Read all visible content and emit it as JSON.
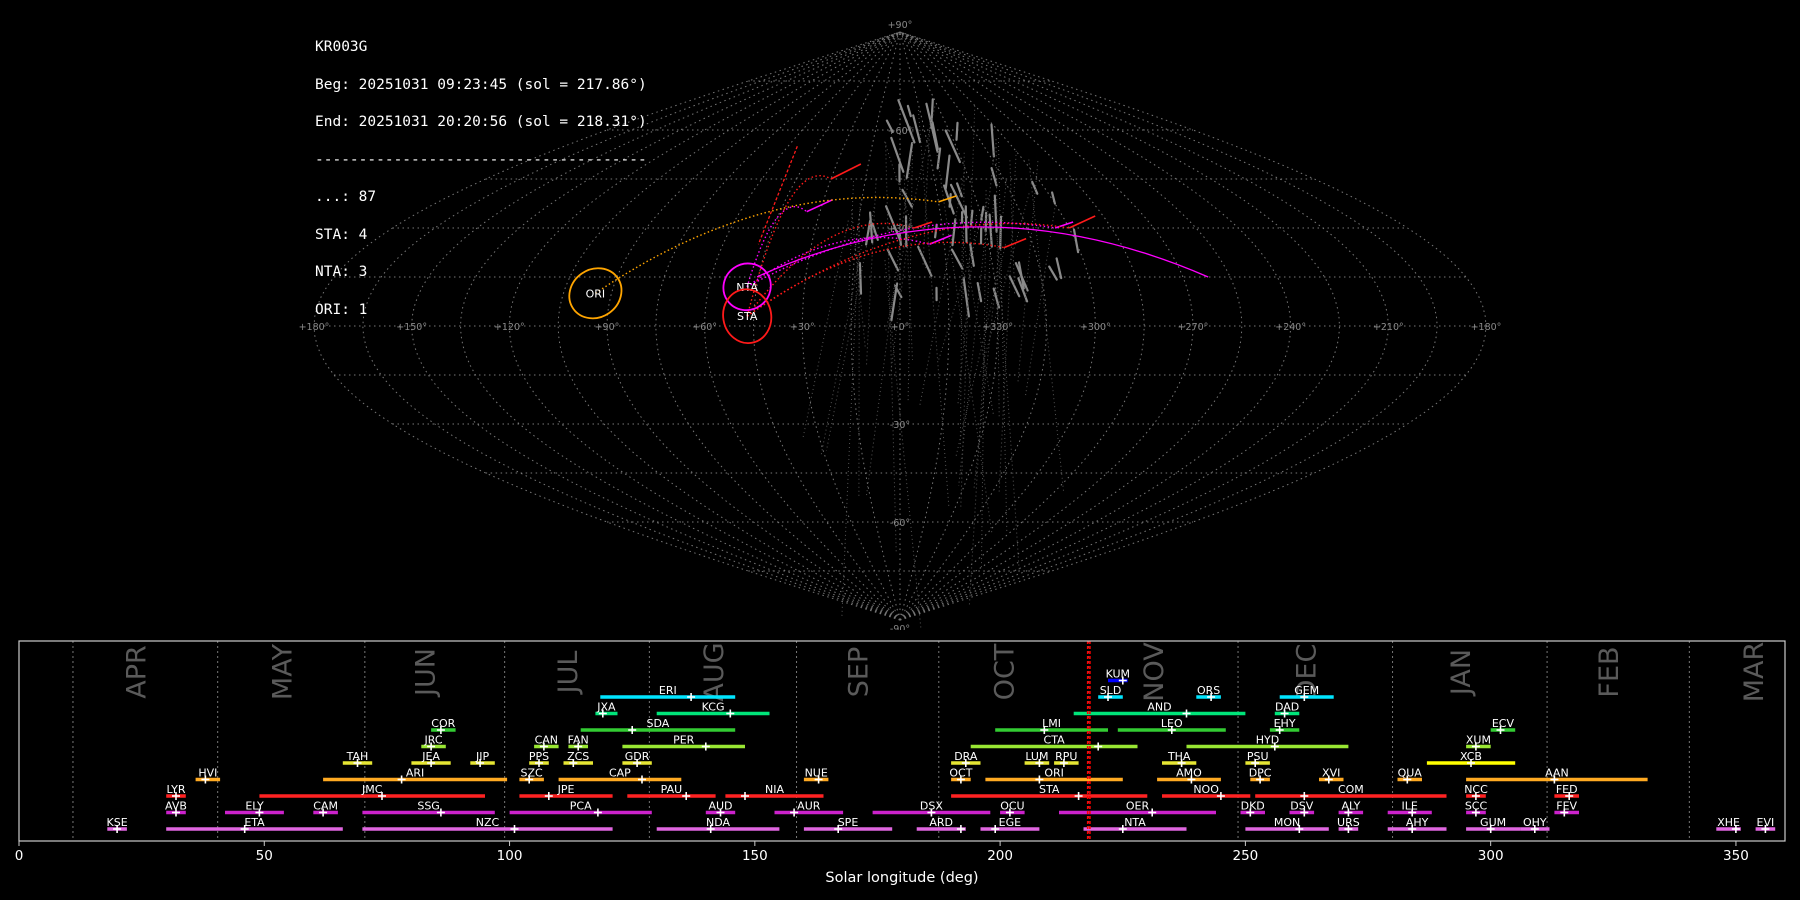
{
  "info": {
    "lines": [
      "KR003G",
      "Beg: 20251031 09:23:45 (sol = 217.86°)",
      "End: 20251031 20:20:56 (sol = 218.31°)",
      "--------------------------------------",
      "...: 87",
      "STA: 4",
      "NTA: 3",
      "ORI: 1"
    ]
  },
  "sky_map": {
    "projection": "sinusoidal",
    "lon_labels": [
      "+180°",
      "+150°",
      "+120°",
      "+90°",
      "+60°",
      "+30°",
      "+0°",
      "+330°",
      "+300°",
      "+270°",
      "+240°",
      "+210°",
      "+180°"
    ],
    "lat_labels": [
      "+90°",
      "+60°",
      "+30°",
      "-30°",
      "-60°",
      "-90°"
    ],
    "radiants": [
      {
        "code": "NTA",
        "lon": 48,
        "lat": 12,
        "color": "#ff00ff"
      },
      {
        "code": "STA",
        "lon": 47,
        "lat": 3,
        "color": "#ff1a1a"
      },
      {
        "code": "ORI",
        "lon": 95,
        "lat": 10,
        "color": "#ffa500"
      }
    ],
    "colors": {
      "sporadic": "#999999",
      "grid": "#777777",
      "text": "#ffffff"
    }
  },
  "chart_data": {
    "type": "timeline",
    "xlabel": "Solar longitude (deg)",
    "xlim": [
      0,
      360
    ],
    "xticks": [
      0,
      50,
      100,
      150,
      200,
      250,
      300,
      350
    ],
    "current_sol": [
      217.86,
      218.31
    ],
    "current_color": "#ff0000",
    "months": [
      {
        "name": "APR",
        "start": 11
      },
      {
        "name": "MAY",
        "start": 40.5
      },
      {
        "name": "JUN",
        "start": 70.5
      },
      {
        "name": "JUL",
        "start": 99
      },
      {
        "name": "AUG",
        "start": 128.5
      },
      {
        "name": "SEP",
        "start": 158.5
      },
      {
        "name": "OCT",
        "start": 187.5
      },
      {
        "name": "NOV",
        "start": 218
      },
      {
        "name": "DEC",
        "start": 248.5
      },
      {
        "name": "JAN",
        "start": 280
      },
      {
        "name": "FEB",
        "start": 311.5
      },
      {
        "name": "MAR",
        "start": 340.5
      }
    ],
    "showers": [
      {
        "code": "KUM",
        "start": 222,
        "end": 226,
        "peak": 225,
        "row": 9,
        "color": "#0000ff"
      },
      {
        "code": "ERI",
        "start": 118.5,
        "end": 146,
        "peak": 137,
        "row": 8,
        "color": "#00e5ff"
      },
      {
        "code": "SLD",
        "start": 220,
        "end": 225,
        "peak": 222,
        "row": 8,
        "color": "#00e5ff"
      },
      {
        "code": "ORS",
        "start": 240,
        "end": 245,
        "peak": 243,
        "row": 8,
        "color": "#00e5ff"
      },
      {
        "code": "GEM",
        "start": 257,
        "end": 268,
        "peak": 262,
        "row": 8,
        "color": "#00e5ff"
      },
      {
        "code": "JXA",
        "start": 117.5,
        "end": 122,
        "peak": 119,
        "row": 7,
        "color": "#00e57a"
      },
      {
        "code": "KCG",
        "start": 130,
        "end": 153,
        "peak": 145,
        "row": 7,
        "color": "#00e57a"
      },
      {
        "code": "AND",
        "start": 215,
        "end": 250,
        "peak": 238,
        "row": 7,
        "color": "#00e57a"
      },
      {
        "code": "DAD",
        "start": 256,
        "end": 261,
        "peak": 258,
        "row": 7,
        "color": "#00e57a"
      },
      {
        "code": "COR",
        "start": 84,
        "end": 89,
        "peak": 86,
        "row": 6,
        "color": "#33cc33"
      },
      {
        "code": "SDA",
        "start": 114.5,
        "end": 146,
        "peak": 125,
        "row": 6,
        "color": "#33cc33"
      },
      {
        "code": "LMI",
        "start": 199,
        "end": 222,
        "peak": 209,
        "row": 6,
        "color": "#33cc33"
      },
      {
        "code": "LEO",
        "start": 224,
        "end": 246,
        "peak": 235,
        "row": 6,
        "color": "#33cc33"
      },
      {
        "code": "EHY",
        "start": 255,
        "end": 261,
        "peak": 257,
        "row": 6,
        "color": "#33cc33"
      },
      {
        "code": "ECV",
        "start": 300,
        "end": 305,
        "peak": 302,
        "row": 6,
        "color": "#33cc33"
      },
      {
        "code": "JRC",
        "start": 82,
        "end": 87,
        "peak": 84,
        "row": 5,
        "color": "#99e633"
      },
      {
        "code": "CAN",
        "start": 105,
        "end": 110,
        "peak": 107,
        "row": 5,
        "color": "#99e633"
      },
      {
        "code": "FAN",
        "start": 112,
        "end": 116,
        "peak": 114,
        "row": 5,
        "color": "#99e633"
      },
      {
        "code": "PER",
        "start": 123,
        "end": 148,
        "peak": 140,
        "row": 5,
        "color": "#99e633"
      },
      {
        "code": "CTA",
        "start": 194,
        "end": 228,
        "peak": 220,
        "row": 5,
        "color": "#99e633"
      },
      {
        "code": "HYD",
        "start": 238,
        "end": 271,
        "peak": 256,
        "row": 5,
        "color": "#99e633"
      },
      {
        "code": "XUM",
        "start": 295,
        "end": 300,
        "peak": 297,
        "row": 5,
        "color": "#99e633"
      },
      {
        "code": "TAH",
        "start": 66,
        "end": 72,
        "peak": 69,
        "row": 4,
        "color": "#e6e633"
      },
      {
        "code": "JEA",
        "start": 80,
        "end": 88,
        "peak": 84,
        "row": 4,
        "color": "#e6e633"
      },
      {
        "code": "JIP",
        "start": 92,
        "end": 97,
        "peak": 94,
        "row": 4,
        "color": "#e6e633"
      },
      {
        "code": "PPS",
        "start": 104,
        "end": 108,
        "peak": 106,
        "row": 4,
        "color": "#e6e633"
      },
      {
        "code": "ZCS",
        "start": 111,
        "end": 117,
        "peak": 113,
        "row": 4,
        "color": "#e6e633"
      },
      {
        "code": "GDR",
        "start": 123,
        "end": 129,
        "peak": 126,
        "row": 4,
        "color": "#e6e633"
      },
      {
        "code": "DRA",
        "start": 190,
        "end": 196,
        "peak": 193,
        "row": 4,
        "color": "#e6e633"
      },
      {
        "code": "LUM",
        "start": 205,
        "end": 210,
        "peak": 208,
        "row": 4,
        "color": "#e6e633"
      },
      {
        "code": "RPU",
        "start": 211,
        "end": 216,
        "peak": 213,
        "row": 4,
        "color": "#e6e633"
      },
      {
        "code": "THA",
        "start": 233,
        "end": 240,
        "peak": 237,
        "row": 4,
        "color": "#e6e633"
      },
      {
        "code": "PSU",
        "start": 250,
        "end": 255,
        "peak": 252,
        "row": 4,
        "color": "#e6e633"
      },
      {
        "code": "XCB",
        "start": 287,
        "end": 305,
        "peak": 296,
        "row": 4,
        "color": "#ffff00"
      },
      {
        "code": "HVI",
        "start": 36,
        "end": 41,
        "peak": 38,
        "row": 3,
        "color": "#ffaa22"
      },
      {
        "code": "ARI",
        "start": 62,
        "end": 99.5,
        "peak": 78,
        "row": 3,
        "color": "#ffaa22"
      },
      {
        "code": "SZC",
        "start": 102,
        "end": 107,
        "peak": 104,
        "row": 3,
        "color": "#ffaa22"
      },
      {
        "code": "CAP",
        "start": 110,
        "end": 135,
        "peak": 127,
        "row": 3,
        "color": "#ffaa22"
      },
      {
        "code": "NUE",
        "start": 160,
        "end": 165,
        "peak": 163,
        "row": 3,
        "color": "#ffaa22"
      },
      {
        "code": "OCT",
        "start": 190,
        "end": 194,
        "peak": 192,
        "row": 3,
        "color": "#ffaa22"
      },
      {
        "code": "ORI",
        "start": 197,
        "end": 225,
        "peak": 208,
        "row": 3,
        "color": "#ffaa22"
      },
      {
        "code": "AMO",
        "start": 232,
        "end": 245,
        "peak": 239,
        "row": 3,
        "color": "#ffaa22"
      },
      {
        "code": "DPC",
        "start": 251,
        "end": 255,
        "peak": 253,
        "row": 3,
        "color": "#ffaa22"
      },
      {
        "code": "XVI",
        "start": 265,
        "end": 270,
        "peak": 267,
        "row": 3,
        "color": "#ffaa22"
      },
      {
        "code": "QUA",
        "start": 281,
        "end": 286,
        "peak": 283,
        "row": 3,
        "color": "#ffaa22"
      },
      {
        "code": "AAN",
        "start": 295,
        "end": 332,
        "peak": 313,
        "row": 3,
        "color": "#ffaa22"
      },
      {
        "code": "LYR",
        "start": 30,
        "end": 34,
        "peak": 32,
        "row": 2,
        "color": "#ff2222"
      },
      {
        "code": "JMC",
        "start": 49,
        "end": 95,
        "peak": 74,
        "row": 2,
        "color": "#ff2222"
      },
      {
        "code": "JPE",
        "start": 102,
        "end": 121,
        "peak": 108,
        "row": 2,
        "color": "#ff2222"
      },
      {
        "code": "PAU",
        "start": 124,
        "end": 142,
        "peak": 136,
        "row": 2,
        "color": "#ff2222"
      },
      {
        "code": "NIA",
        "start": 144,
        "end": 164,
        "peak": 148,
        "row": 2,
        "color": "#ff2222"
      },
      {
        "code": "STA",
        "start": 190,
        "end": 230,
        "peak": 216,
        "row": 2,
        "color": "#ff2222"
      },
      {
        "code": "NOO",
        "start": 233,
        "end": 251,
        "peak": 245,
        "row": 2,
        "color": "#ff2222"
      },
      {
        "code": "COM",
        "start": 252,
        "end": 291,
        "peak": 262,
        "row": 2,
        "color": "#ff2222"
      },
      {
        "code": "NCC",
        "start": 295,
        "end": 299,
        "peak": 297,
        "row": 2,
        "color": "#ff2222"
      },
      {
        "code": "FED",
        "start": 313,
        "end": 318,
        "peak": 316,
        "row": 2,
        "color": "#ff2222"
      },
      {
        "code": "AVB",
        "start": 30,
        "end": 34,
        "peak": 32,
        "row": 1,
        "color": "#cc22cc"
      },
      {
        "code": "ELY",
        "start": 42,
        "end": 54,
        "peak": 49,
        "row": 1,
        "color": "#cc22cc"
      },
      {
        "code": "CAM",
        "start": 60,
        "end": 65,
        "peak": 62,
        "row": 1,
        "color": "#cc22cc"
      },
      {
        "code": "SSG",
        "start": 70,
        "end": 97,
        "peak": 86,
        "row": 1,
        "color": "#cc22cc"
      },
      {
        "code": "PCA",
        "start": 100,
        "end": 129,
        "peak": 118,
        "row": 1,
        "color": "#cc22cc"
      },
      {
        "code": "AUD",
        "start": 140,
        "end": 146,
        "peak": 143,
        "row": 1,
        "color": "#cc22cc"
      },
      {
        "code": "AUR",
        "start": 154,
        "end": 168,
        "peak": 158,
        "row": 1,
        "color": "#cc22cc"
      },
      {
        "code": "DSX",
        "start": 174,
        "end": 198,
        "peak": 186,
        "row": 1,
        "color": "#cc22cc"
      },
      {
        "code": "OCU",
        "start": 200,
        "end": 205,
        "peak": 202,
        "row": 1,
        "color": "#cc22cc"
      },
      {
        "code": "OER",
        "start": 212,
        "end": 244,
        "peak": 231,
        "row": 1,
        "color": "#cc22cc"
      },
      {
        "code": "DKD",
        "start": 249,
        "end": 254,
        "peak": 251,
        "row": 1,
        "color": "#cc22cc"
      },
      {
        "code": "DSV",
        "start": 259,
        "end": 264,
        "peak": 262,
        "row": 1,
        "color": "#cc22cc"
      },
      {
        "code": "ALY",
        "start": 269,
        "end": 274,
        "peak": 271,
        "row": 1,
        "color": "#cc22cc"
      },
      {
        "code": "ILE",
        "start": 279,
        "end": 288,
        "peak": 284,
        "row": 1,
        "color": "#cc22cc"
      },
      {
        "code": "SCC",
        "start": 295,
        "end": 299,
        "peak": 297,
        "row": 1,
        "color": "#cc22cc"
      },
      {
        "code": "FEV",
        "start": 313,
        "end": 318,
        "peak": 315,
        "row": 1,
        "color": "#cc22cc"
      },
      {
        "code": "KSE",
        "start": 18,
        "end": 22,
        "peak": 20,
        "row": 0,
        "color": "#e066e0"
      },
      {
        "code": "ETA",
        "start": 30,
        "end": 66,
        "peak": 46,
        "row": 0,
        "color": "#e066e0"
      },
      {
        "code": "NZC",
        "start": 70,
        "end": 121,
        "peak": 101,
        "row": 0,
        "color": "#e066e0"
      },
      {
        "code": "NDA",
        "start": 130,
        "end": 155,
        "peak": 141,
        "row": 0,
        "color": "#e066e0"
      },
      {
        "code": "SPE",
        "start": 160,
        "end": 178,
        "peak": 167,
        "row": 0,
        "color": "#e066e0"
      },
      {
        "code": "ARD",
        "start": 183,
        "end": 193,
        "peak": 192,
        "row": 0,
        "color": "#e066e0"
      },
      {
        "code": "EGE",
        "start": 196,
        "end": 208,
        "peak": 199,
        "row": 0,
        "color": "#e066e0"
      },
      {
        "code": "NTA",
        "start": 217,
        "end": 238,
        "peak": 225,
        "row": 0,
        "color": "#e066e0"
      },
      {
        "code": "MON",
        "start": 250,
        "end": 267,
        "peak": 261,
        "row": 0,
        "color": "#e066e0"
      },
      {
        "code": "URS",
        "start": 269,
        "end": 273,
        "peak": 271,
        "row": 0,
        "color": "#e066e0"
      },
      {
        "code": "AHY",
        "start": 279,
        "end": 291,
        "peak": 284,
        "row": 0,
        "color": "#e066e0"
      },
      {
        "code": "GUM",
        "start": 295,
        "end": 306,
        "peak": 300,
        "row": 0,
        "color": "#e066e0"
      },
      {
        "code": "OHY",
        "start": 306,
        "end": 312,
        "peak": 309,
        "row": 0,
        "color": "#e066e0"
      },
      {
        "code": "XHE",
        "start": 346,
        "end": 351,
        "peak": 350,
        "row": 0,
        "color": "#e066e0"
      },
      {
        "code": "EVI",
        "start": 354,
        "end": 358,
        "peak": 356,
        "row": 0,
        "color": "#e066e0"
      }
    ]
  }
}
